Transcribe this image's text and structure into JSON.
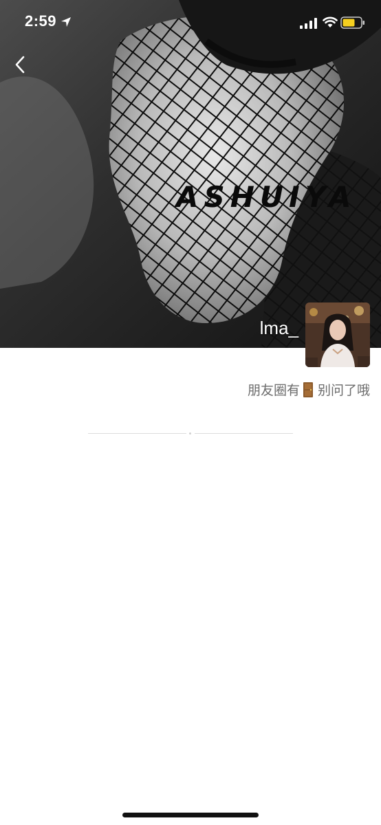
{
  "status_bar": {
    "time": "2:59",
    "location_icon": "location-arrow-icon",
    "signal_icon": "cellular-signal-icon",
    "wifi_icon": "wifi-icon",
    "battery_icon": "battery-icon",
    "battery_color": "#f5d020"
  },
  "navigation": {
    "back_icon": "chevron-left-icon"
  },
  "cover": {
    "watermark": "ASHUIYA"
  },
  "profile": {
    "name": "lma_",
    "signature_before": "朋友圈有",
    "signature_icon": "door-icon",
    "signature_after": "别问了哦"
  },
  "colors": {
    "page_background": "#ffffff",
    "signature_text": "#6b6b6b",
    "divider": "#dcdcdc"
  }
}
